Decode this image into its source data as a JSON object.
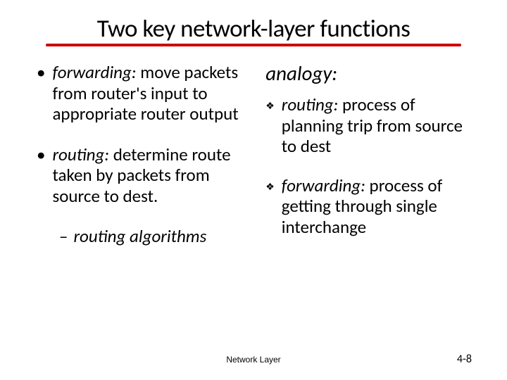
{
  "title": "Two key network-layer functions",
  "left": {
    "b1_term": "forwarding:",
    "b1_rest": " move packets from router's input to appropriate router output",
    "b2_term": "routing:",
    "b2_rest": " determine route taken by packets from source to dest.",
    "sub": "routing algorithms"
  },
  "right": {
    "heading": "analogy:",
    "d1_term": "routing:",
    "d1_rest": " process of planning trip from source to dest",
    "d2_term": "forwarding:",
    "d2_rest": " process of getting through single interchange"
  },
  "footer": {
    "center": "Network Layer",
    "right": "4-8"
  }
}
